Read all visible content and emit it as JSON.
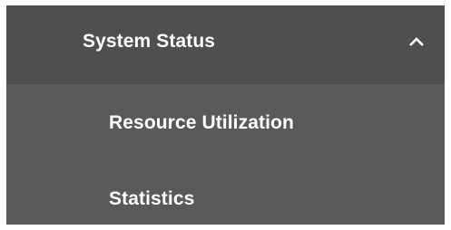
{
  "menu": {
    "header": {
      "label": "System Status",
      "expanded_icon": "chevron-up-icon"
    },
    "items": [
      {
        "label": "Resource Utilization"
      },
      {
        "label": "Statistics"
      }
    ]
  },
  "colors": {
    "header_background": "#4f4f4f",
    "panel_background": "#595959",
    "text": "#ffffff"
  }
}
